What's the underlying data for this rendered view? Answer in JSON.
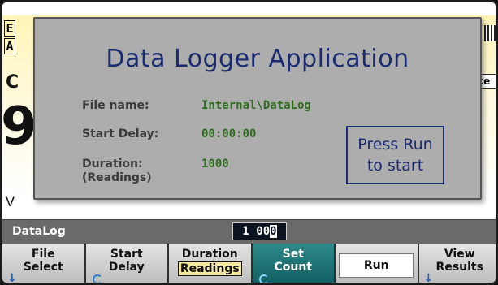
{
  "background": {
    "fragments": [
      "E",
      "A",
      "C",
      "9",
      "V"
    ],
    "chip": "ce"
  },
  "dialog": {
    "title": "Data Logger Application",
    "fields": [
      {
        "label": "File name:",
        "value": "Internal\\DataLog"
      },
      {
        "label": "Start Delay:",
        "value": "00:00:00"
      },
      {
        "label": "Duration:",
        "label2": "(Readings)",
        "value": "1000"
      }
    ],
    "press_line1": "Press Run",
    "press_line2": "to start"
  },
  "input": {
    "label": "DataLog",
    "value_prefix": "1 00",
    "value_cursor": "0"
  },
  "softkeys": [
    {
      "line1": "File",
      "line2": "Select"
    },
    {
      "line1": "Start",
      "line2": "Delay"
    },
    {
      "line1": "Duration",
      "line2": "Readings"
    },
    {
      "line1": "Set",
      "line2": "Count"
    },
    {
      "line1": "Run"
    },
    {
      "line1": "View",
      "line2": "Results"
    }
  ],
  "colors": {
    "title": "#1a2a70",
    "value_green": "#2e6b1e",
    "active_key": "#1a6e72",
    "dialog_bg": "#adadad"
  }
}
